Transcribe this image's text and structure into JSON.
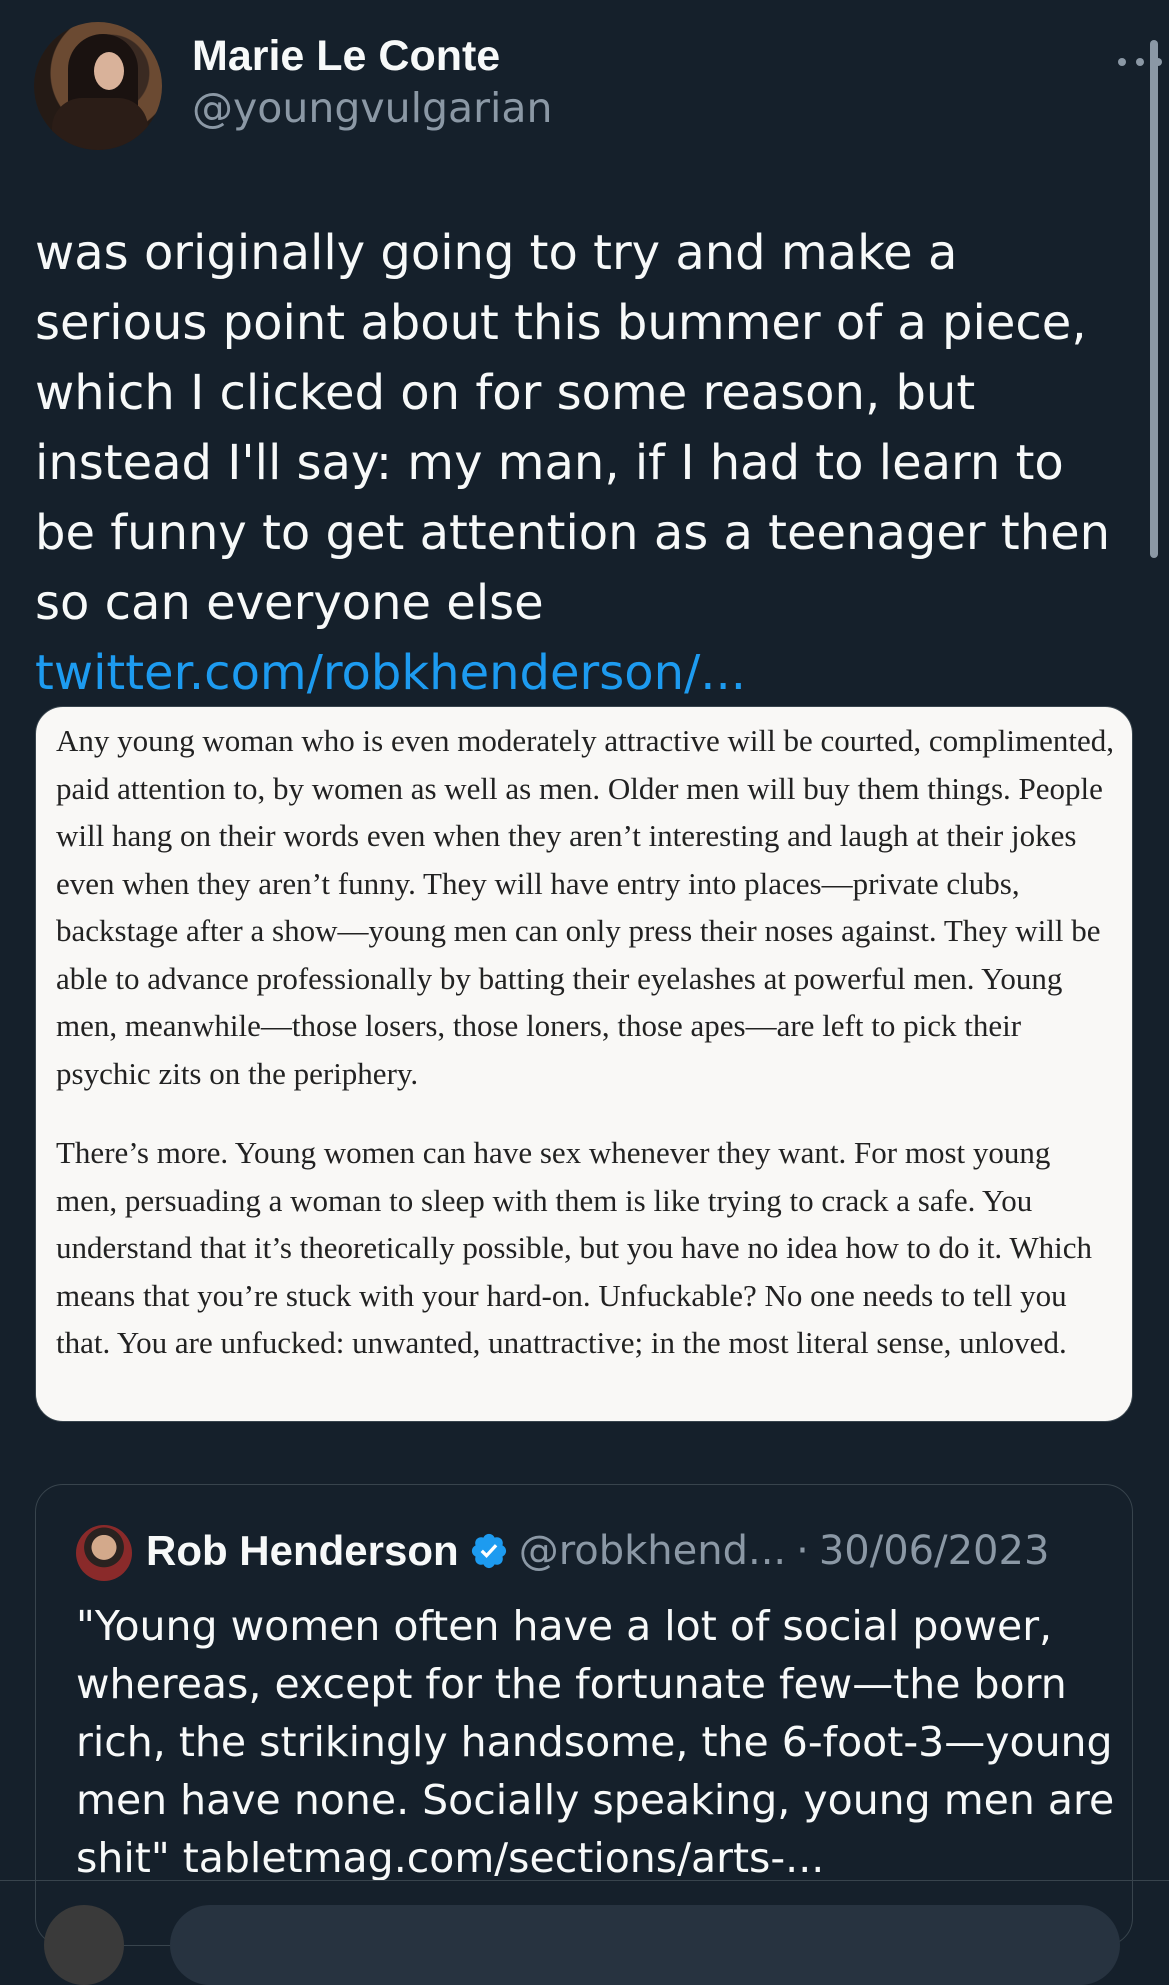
{
  "author": {
    "name": "Marie Le Conte",
    "handle": "@youngvulgarian"
  },
  "tweet": {
    "text": "was originally going to try and make a serious point about this bummer of a piece, which I clicked on for some reason, but instead I'll say: my man, if I had to learn to be funny to get attention as a teenager then so can everyone else ",
    "link_text": "twitter.com/robkhenderson/..."
  },
  "image_excerpt": {
    "paragraph_1": "Any young woman who is even moderately attractive will be courted, complimented, paid attention to, by women as well as men. Older men will buy them things. People will hang on their words even when they aren’t interesting and laugh at their jokes even when they aren’t funny. They will have entry into places—private clubs, backstage after a show—young men can only press their noses against. They will be able to advance professionally by batting their eyelashes at powerful men. Young men, meanwhile—those losers, those loners, those apes—are left to pick their psychic zits on the periphery.",
    "paragraph_2": "There’s more. Young women can have sex whenever they want. For most young men, persuading a woman to sleep with them is like trying to crack a safe. You understand that it’s theoretically possible, but you have no idea how to do it. Which means that you’re stuck with your hard-on. Unfuckable? No one needs to tell you that. You are unfucked: unwanted, unattractive; in the most literal sense, unloved."
  },
  "quoted_tweet": {
    "name": "Rob Henderson",
    "handle": "@robkhend...",
    "separator": "·",
    "date": "30/06/2023",
    "text": "\"Young women often have a lot of social power, whereas, except for the fortunate few—the born rich, the strikingly handsome, the 6-foot-3—young men have none. Socially speaking, young men are shit\" tabletmag.com/sections/arts-..."
  },
  "icons": {
    "more": "more-horizontal-icon",
    "verified": "verified-badge-icon"
  },
  "colors": {
    "background": "#15202b",
    "link": "#1d9bf0",
    "secondary_text": "#8b98a5",
    "verified": "#1d9bf0"
  }
}
